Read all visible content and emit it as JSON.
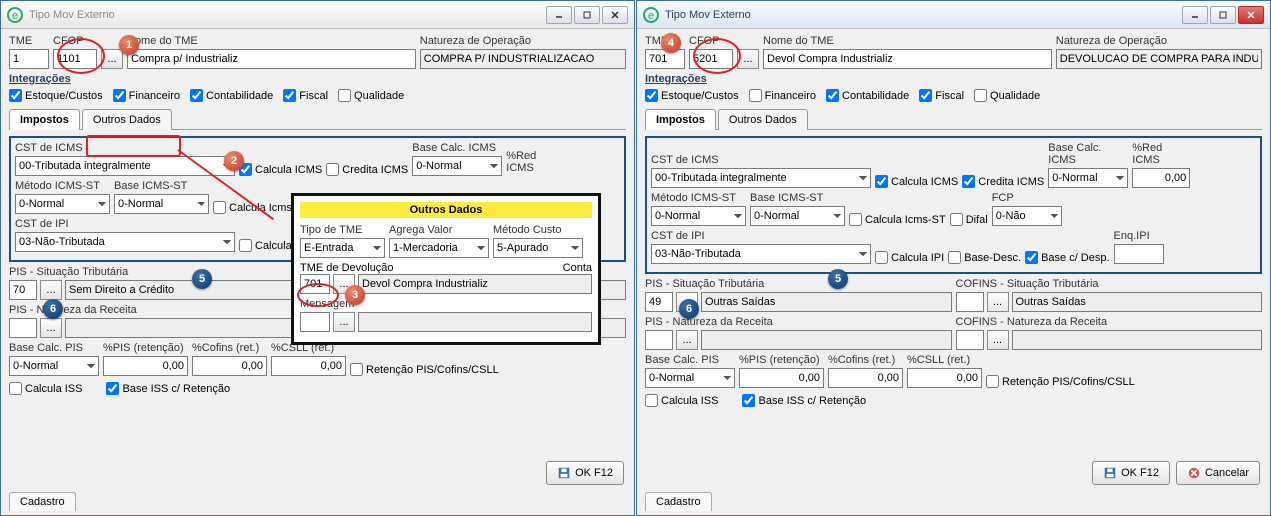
{
  "left": {
    "title": "Tipo Mov Externo",
    "tme_label": "TME",
    "tme": "1",
    "cfop_label": "CFOP",
    "cfop": "1101",
    "nome_label": "Nome do TME",
    "nome": "Compra p/ Industrializ",
    "natureza_label": "Natureza de Operação",
    "natureza": "COMPRA P/ INDUSTRIALIZACAO",
    "integracoes_label": "Integrações",
    "integ": {
      "estoque": "Estoque/Custos",
      "financeiro": "Financeiro",
      "contabilidade": "Contabilidade",
      "fiscal": "Fiscal",
      "qualidade": "Qualidade"
    },
    "tab_impostos": "Impostos",
    "tab_outros": "Outros Dados",
    "cst_icms_label": "CST de ICMS",
    "cst_icms": "00-Tributada integralmente",
    "calcula_icms": "Calcula ICMS",
    "credita_icms": "Credita ICMS",
    "base_calc_icms_label": "Base Calc. ICMS",
    "base_calc_icms": "0-Normal",
    "red_icms_label": "%Red ICMS",
    "metodo_icmsst_label": "Método ICMS-ST",
    "metodo_icmsst": "0-Normal",
    "base_icmsst_label": "Base ICMS-ST",
    "base_icmsst": "0-Normal",
    "calcula_icmsst": "Calcula Icms-ST",
    "cst_ipi_label": "CST de IPI",
    "cst_ipi": "03-Não-Tributada",
    "calcula_ipi": "Calcula IPI",
    "pis_sit_label": "PIS - Situação Tributária",
    "pis_code": "70",
    "pis_desc": "Sem Direito a Crédito",
    "pis_nat_label": "PIS - Natureza da Receita",
    "base_calc_pis_label": "Base Calc. PIS",
    "base_calc_pis": "0-Normal",
    "pis_ret": "%PIS (retenção)",
    "cofins_ret": "%Cofins (ret.)",
    "csll_ret": "%CSLL (ret.)",
    "zero": "0,00",
    "ret_chk": "Retenção PIS/Cofins/CSLL",
    "calcula_iss": "Calcula ISS",
    "base_iss": "Base ISS c/ Retenção",
    "popup": {
      "title": "Outros Dados",
      "tipo_tme_label": "Tipo de TME",
      "tipo_tme": "E-Entrada",
      "agrega_label": "Agrega Valor",
      "agrega": "1-Mercadoria",
      "metodo_custo_label": "Método Custo",
      "metodo_custo": "5-Apurado",
      "tme_dev_label": "TME de Devolução",
      "tme_dev": "701",
      "tme_dev_nome": "Devol Compra Industrializ",
      "conta_label": "Conta",
      "mensagem_label": "Mensagem"
    },
    "ok": "OK  F12",
    "cadastro": "Cadastro"
  },
  "right": {
    "title": "Tipo Mov Externo",
    "tme_label": "TME",
    "tme": "701",
    "cfop_label": "CFOP",
    "cfop": "5201",
    "nome_label": "Nome do TME",
    "nome": "Devol Compra Industrializ",
    "natureza_label": "Natureza de Operação",
    "natureza": "DEVOLUCAO DE COMPRA PARA INDUSTRIALIZ",
    "integracoes_label": "Integrações",
    "integ": {
      "estoque": "Estoque/Custos",
      "financeiro": "Financeiro",
      "contabilidade": "Contabilidade",
      "fiscal": "Fiscal",
      "qualidade": "Qualidade"
    },
    "tab_impostos": "Impostos",
    "tab_outros": "Outros Dados",
    "cst_icms_label": "CST de ICMS",
    "cst_icms": "00-Tributada integralmente",
    "calcula_icms": "Calcula ICMS",
    "credita_icms": "Credita ICMS",
    "base_calc_icms_label": "Base Calc. ICMS",
    "base_calc_icms": "0-Normal",
    "red_icms_label": "%Red ICMS",
    "red_icms": "0,00",
    "metodo_icmsst_label": "Método ICMS-ST",
    "metodo_icmsst": "0-Normal",
    "base_icmsst_label": "Base ICMS-ST",
    "base_icmsst": "0-Normal",
    "calcula_icmsst": "Calcula Icms-ST",
    "difal": "Difal",
    "fcp_label": "FCP",
    "fcp": "0-Não",
    "cst_ipi_label": "CST de IPI",
    "cst_ipi": "03-Não-Tributada",
    "calcula_ipi": "Calcula IPI",
    "base_desc": "Base-Desc.",
    "base_desp": "Base c/ Desp.",
    "enq_ipi_label": "Enq.IPI",
    "pis_sit_label": "PIS - Situação Tributária",
    "pis_code": "49",
    "pis_desc": "Outras Saídas",
    "cofins_sit_label": "COFINS - Situação Tributária",
    "cofins_desc": "Outras Saídas",
    "pis_nat_label": "PIS - Natureza da Receita",
    "cofins_nat_label": "COFINS - Natureza da Receita",
    "base_calc_pis_label": "Base Calc. PIS",
    "base_calc_pis": "0-Normal",
    "pis_ret": "%PIS (retenção)",
    "cofins_ret": "%Cofins (ret.)",
    "csll_ret": "%CSLL (ret.)",
    "zero": "0,00",
    "ret_chk": "Retenção PIS/Cofins/CSLL",
    "calcula_iss": "Calcula ISS",
    "base_iss": "Base ISS c/ Retenção",
    "ok": "OK  F12",
    "cancel": "Cancelar",
    "cadastro": "Cadastro"
  }
}
